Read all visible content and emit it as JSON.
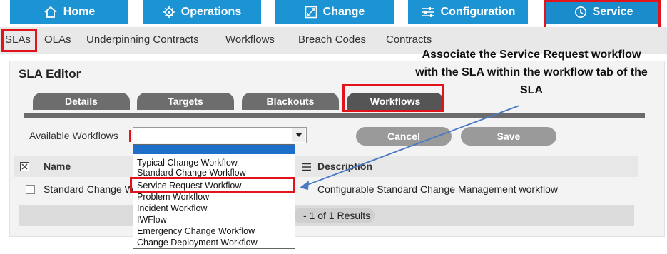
{
  "top_nav": {
    "home": "Home",
    "operations": "Operations",
    "change": "Change",
    "configuration": "Configuration",
    "service": "Service"
  },
  "sub_nav": [
    "SLAs",
    "OLAs",
    "Underpinning Contracts",
    "Workflows",
    "Breach Codes",
    "Contracts"
  ],
  "editor": {
    "title": "SLA Editor",
    "tabs": [
      "Details",
      "Targets",
      "Blackouts",
      "Workflows"
    ],
    "active_tab": "Workflows",
    "available_workflows_label": "Available Workflows",
    "cancel_label": "Cancel",
    "save_label": "Save",
    "columns": {
      "name": "Name",
      "description": "Description"
    },
    "rows": [
      {
        "name": "Standard Change W",
        "description": "Configurable Standard Change Management workflow"
      }
    ],
    "pager_text": "- 1 of 1 Results"
  },
  "workflow_options": [
    "Typical Change Workflow",
    "Standard Change Workflow",
    "Service Request Workflow",
    "Problem Workflow",
    "Incident Workflow",
    "IWFlow",
    "Emergency Change Workflow",
    "Change Deployment Workflow"
  ],
  "highlighted_option": "Service Request Workflow",
  "annotation": {
    "line1": "Associate the Service Request workflow",
    "line2": "with the SLA within the workflow tab of the",
    "line3": "SLA"
  },
  "colors": {
    "nav_blue": "#1c94d4",
    "highlight_red": "#e0141a",
    "arrow_blue": "#4a78c2",
    "tab_gray": "#6d6d6d"
  }
}
